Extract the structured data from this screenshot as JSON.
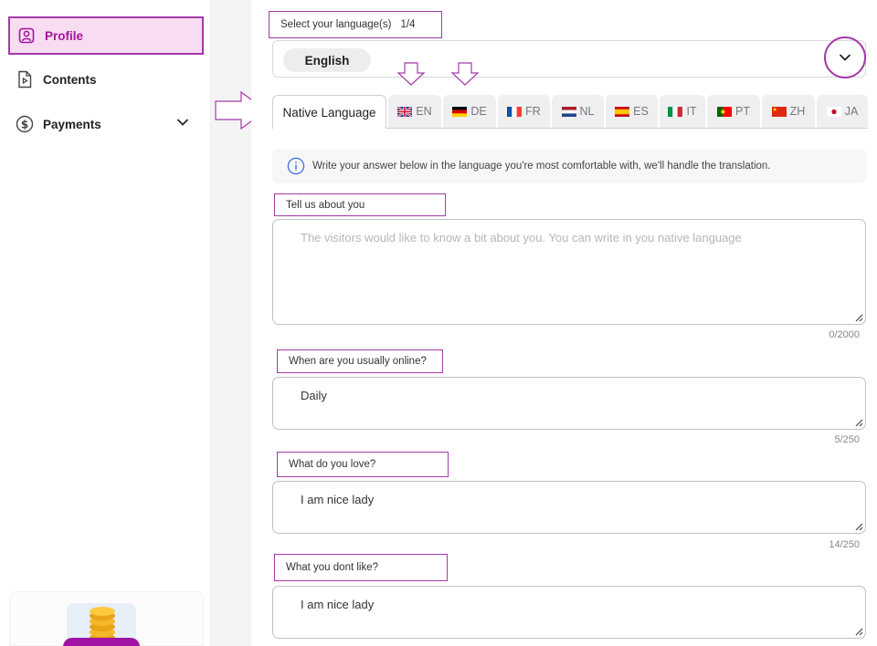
{
  "sidebar": {
    "items": [
      {
        "label": "Profile",
        "icon": "user-icon",
        "active": true
      },
      {
        "label": "Contents",
        "icon": "file-video-icon",
        "active": false
      },
      {
        "label": "Payments",
        "icon": "dollar-icon",
        "active": false,
        "expandable": true
      }
    ]
  },
  "language": {
    "title": "Select your language(s)",
    "count": "1/4",
    "selected": "English"
  },
  "tabs": [
    {
      "label": "Native Language",
      "flag": ""
    },
    {
      "label": "EN",
      "flag": "uk-flag-icon"
    },
    {
      "label": "DE",
      "flag": "germany-flag-icon"
    },
    {
      "label": "FR",
      "flag": "france-flag-icon"
    },
    {
      "label": "NL",
      "flag": "netherlands-flag-icon"
    },
    {
      "label": "ES",
      "flag": "spain-flag-icon"
    },
    {
      "label": "IT",
      "flag": "italy-flag-icon"
    },
    {
      "label": "PT",
      "flag": "portugal-flag-icon"
    },
    {
      "label": "ZH",
      "flag": "china-flag-icon"
    },
    {
      "label": "JA",
      "flag": "japan-flag-icon"
    }
  ],
  "info": {
    "text": "Write your answer below in the language you're most comfortable with, we'll handle the translation."
  },
  "fields": [
    {
      "label": "Tell us about you",
      "value": "",
      "placeholder": "The visitors would like to know a bit about you. You can write in you native language",
      "counter": "0/2000"
    },
    {
      "label": "When are you usually online?",
      "value": "Daily",
      "placeholder": "",
      "counter": "5/250"
    },
    {
      "label": "What do you love?",
      "value": "I am nice lady",
      "placeholder": "",
      "counter": "14/250"
    },
    {
      "label": "What you dont like?",
      "value": "I am nice lady",
      "placeholder": "",
      "counter": ""
    }
  ],
  "colors": {
    "accent": "#a43aa9",
    "active_bg": "#f8dcf2",
    "active_text": "#a4139c"
  }
}
